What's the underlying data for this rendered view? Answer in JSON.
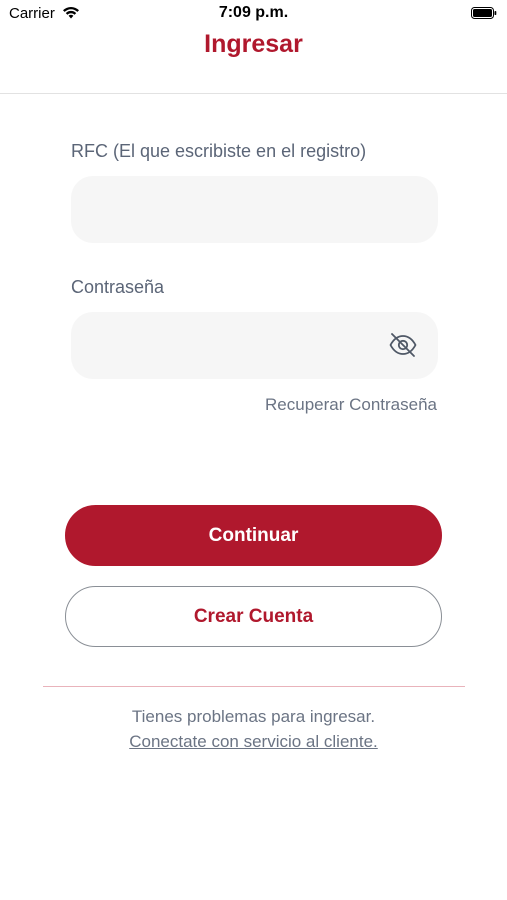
{
  "status_bar": {
    "carrier": "Carrier",
    "time": "7:09 p.m.",
    "wifi_icon": "wifi-icon",
    "battery_icon": "battery-icon"
  },
  "header": {
    "title": "Ingresar"
  },
  "form": {
    "rfc": {
      "label": "RFC (El que escribiste en el registro)",
      "value": "",
      "placeholder": ""
    },
    "password": {
      "label": "Contraseña",
      "value": "",
      "placeholder": "",
      "toggle_icon": "eye-slash-icon"
    },
    "recover_label": "Recuperar Contraseña"
  },
  "actions": {
    "continue_label": "Continuar",
    "create_account_label": "Crear Cuenta"
  },
  "footer": {
    "help_text": "Tienes problemas para ingresar.",
    "help_link": "Conectate con servicio al cliente."
  },
  "colors": {
    "brand": "#b0182d",
    "text_muted": "#6b7484",
    "input_bg": "#f6f6f6"
  }
}
